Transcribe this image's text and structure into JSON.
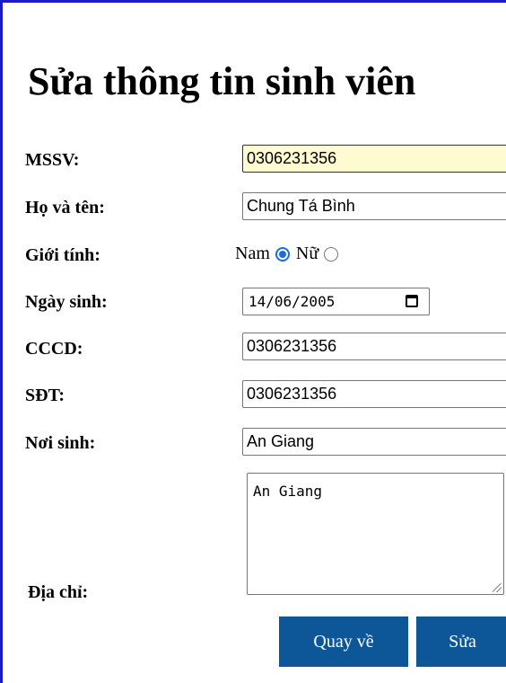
{
  "page": {
    "title": "Sửa thông tin sinh viên"
  },
  "form": {
    "mssv": {
      "label": "MSSV:",
      "value": "0306231356"
    },
    "ho_ten": {
      "label": "Họ và tên:",
      "value": "Chung Tá Bình"
    },
    "gioi_tinh": {
      "label": "Giới tính:",
      "options": [
        {
          "label": "Nam",
          "checked": true
        },
        {
          "label": "Nữ",
          "checked": false
        }
      ]
    },
    "ngay_sinh": {
      "label": "Ngày sinh:",
      "value": "14/06/2005"
    },
    "cccd": {
      "label": "CCCD:",
      "value": "0306231356"
    },
    "sdt": {
      "label": "SĐT:",
      "value": "0306231356"
    },
    "noi_sinh": {
      "label": "Nơi sinh:",
      "value": "An Giang"
    },
    "dia_chi": {
      "label": "Địa chỉ:",
      "value": "An Giang"
    }
  },
  "buttons": {
    "back_label": "Quay về",
    "submit_label": "Sửa"
  },
  "colors": {
    "frame_border": "#1a1acb",
    "button_bg": "#0d5697",
    "focused_field_bg": "#fffbd0",
    "radio_accent": "#1a6ce0"
  },
  "icons": {
    "date_picker": "calendar-icon",
    "textarea_resize": "resize-grip-icon"
  }
}
